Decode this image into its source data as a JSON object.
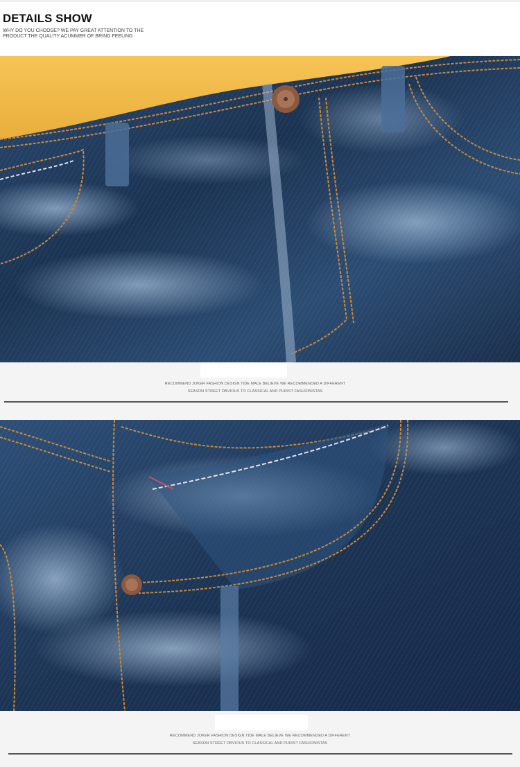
{
  "header": {
    "title": "DETAILS SHOW",
    "subtitle_line1": "WHY DO YOU CHOOSE? WE PAY GREAT ATTENTION TO THE",
    "subtitle_line2": "PRODUCT THE QUALITY ACUMMER OF BRING FEELING"
  },
  "sections": [
    {
      "caption_line1": "RECOMMEND JOKER FASHION DESIGN TIDE MALE BELIEVE WE RECOMMENDED A DIFFERENT",
      "caption_line2": "SEASON STREET OBVIOUS TO CLASSICAL AND PURIST FASHIONISTAS"
    },
    {
      "caption_line1": "RECOMMEND JOKER FASHION DESIGN TIDE MALE BELIEVE WE RECOMMENDED A DIFFERENT",
      "caption_line2": "SEASON STREET OBVIOUS TO CLASSICAL AND PURIST FASHIONISTAS"
    }
  ],
  "colors": {
    "denim_dark": "#1e3656",
    "denim_light": "#6f8fb2",
    "stitch": "#c98a3e",
    "stitch_white": "#e8e2e6",
    "shirt": "#f0b94a",
    "rivet": "#9a6a4a"
  }
}
